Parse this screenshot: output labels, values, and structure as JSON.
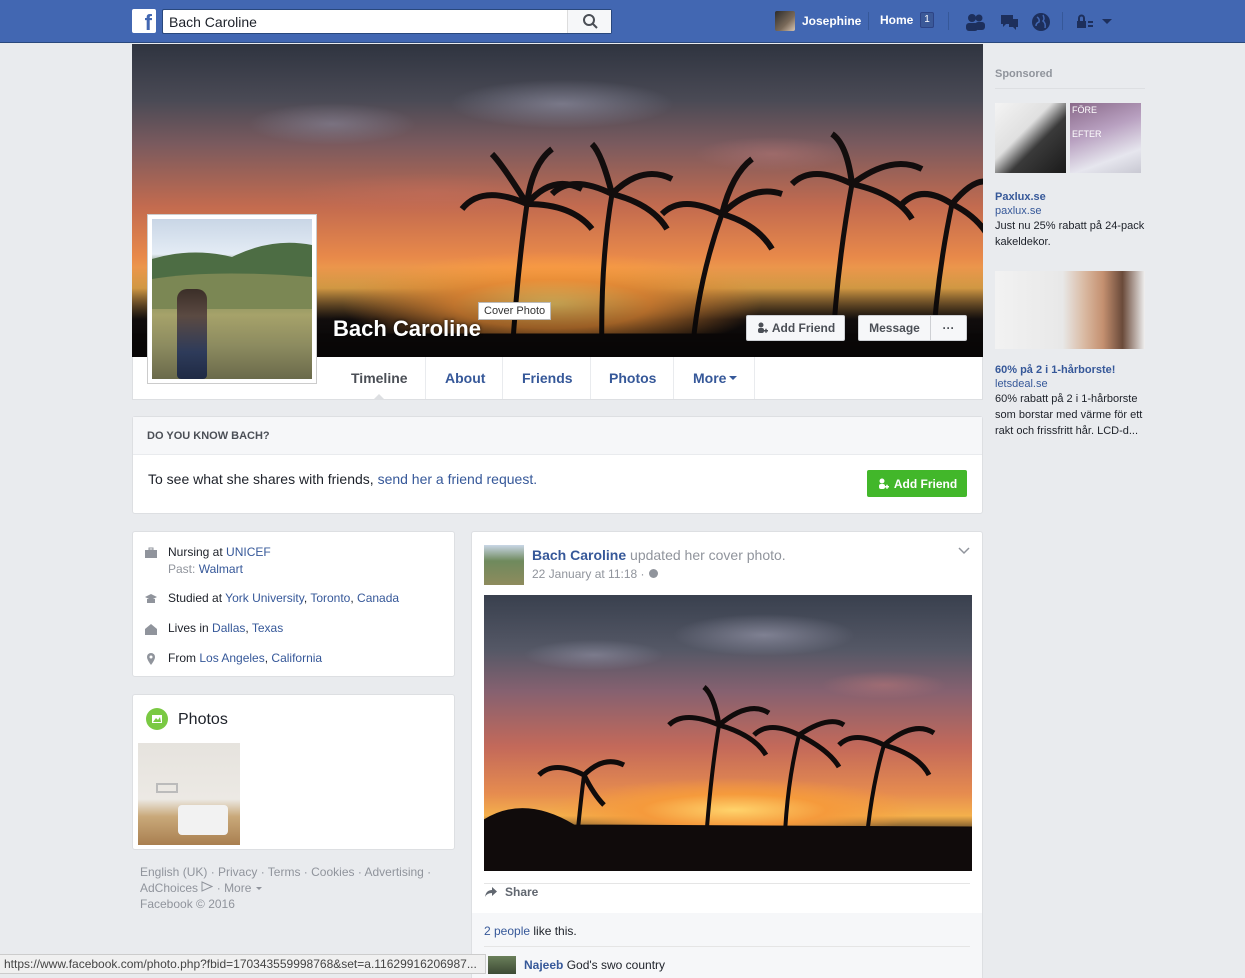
{
  "topbar": {
    "logo": "f",
    "search_value": "Bach Caroline",
    "user_name": "Josephine",
    "home_label": "Home",
    "home_badge": "1"
  },
  "cover": {
    "name": "Bach Caroline",
    "tooltip": "Cover Photo",
    "add_friend_label": "Add Friend",
    "message_label": "Message",
    "more_label": "···"
  },
  "tabs": [
    {
      "label": "Timeline"
    },
    {
      "label": "About"
    },
    {
      "label": "Friends"
    },
    {
      "label": "Photos"
    },
    {
      "label": "More"
    }
  ],
  "know": {
    "title": "DO YOU KNOW BACH?",
    "text": "To see what she shares with friends, ",
    "link": "send her a friend request.",
    "button": "Add Friend"
  },
  "intro": {
    "work_prefix": "Nursing at ",
    "work_org": "UNICEF",
    "past_prefix": "Past: ",
    "past_org": "Walmart",
    "studied_prefix": "Studied at ",
    "studied_school": "York University",
    "studied_city": "Toronto",
    "studied_country": "Canada",
    "lives_prefix": "Lives in ",
    "lives_city": "Dallas",
    "lives_state": "Texas",
    "from_prefix": "From ",
    "from_city": "Los Angeles",
    "from_state": "California",
    "sep": ", "
  },
  "photos_card": {
    "title": "Photos"
  },
  "footer": {
    "line1": "English (UK) · Privacy · Terms · Cookies · Advertising ·",
    "adchoices": "AdChoices",
    "more": "More",
    "copyright": "Facebook © 2016"
  },
  "post": {
    "author": "Bach Caroline",
    "action": " updated her cover photo.",
    "time": "22 January at 11:18 · ",
    "share": "Share",
    "likes_link": "2 people",
    "likes_text": " like this.",
    "comment_author": "Najeeb",
    "comment_text": "God's swo country"
  },
  "sidebar": {
    "sponsored": "Sponsored",
    "ad1_overlay_top": "FÖRE",
    "ad1_overlay_bottom": "EFTER",
    "ad1_title": "Paxlux.se",
    "ad1_domain": "paxlux.se",
    "ad1_text": "Just nu 25% rabatt på 24-pack kakeldekor.",
    "ad2_title": "60% på 2 i 1-hårborste!",
    "ad2_domain": "letsdeal.se",
    "ad2_text": "60% rabatt på 2 i 1-hårborste som borstar med värme för ett rakt och frissfritt hår. LCD-d..."
  },
  "statusbar": {
    "url": "https://www.facebook.com/photo.php?fbid=170343559998768&set=a.11629916206987..."
  },
  "colors": {
    "brand": "#4267b2",
    "link": "#365899",
    "green": "#42b72a"
  }
}
